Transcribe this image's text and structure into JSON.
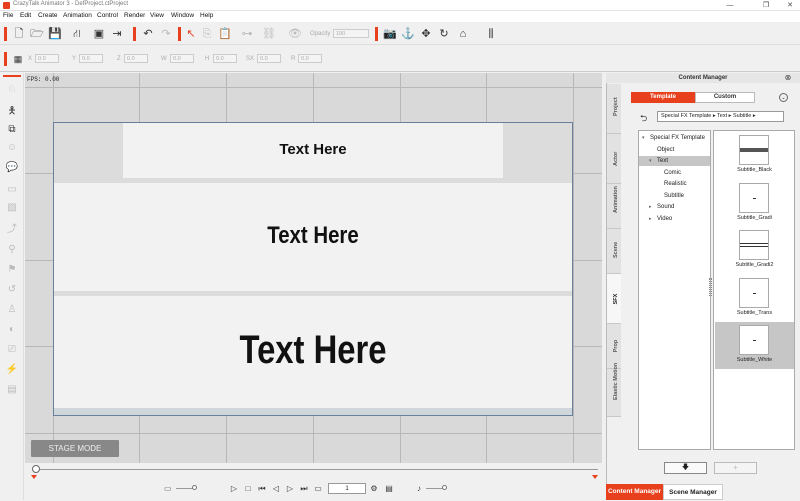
{
  "window": {
    "title": "CrazyTalk Animator 3  -  DefProject.ctProject",
    "min": "—",
    "max": "❐",
    "close": "✕"
  },
  "menu": [
    "File",
    "Edit",
    "Create",
    "Animation",
    "Control",
    "Render",
    "View",
    "Window",
    "Help"
  ],
  "toolbar": {
    "opacity_label": "Opacity",
    "opacity_value": "100"
  },
  "transform_fields": [
    {
      "label": "X",
      "value": "0.0"
    },
    {
      "label": "Y",
      "value": "0.0"
    },
    {
      "label": "Z",
      "value": "0.0"
    },
    {
      "label": "W",
      "value": "0.0"
    },
    {
      "label": "H",
      "value": "0.0"
    },
    {
      "label": "SX",
      "value": "0.0"
    },
    {
      "label": "R",
      "value": "0.0"
    }
  ],
  "stage": {
    "fps": "FPS: 0.00",
    "text_small": "Text Here",
    "text_medium": "Text Here",
    "text_large": "Text Here",
    "stage_mode": "STAGE MODE"
  },
  "timeline": {
    "frame": "1"
  },
  "content_manager": {
    "title": "Content Manager",
    "tabs": {
      "template": "Template",
      "custom": "Custom"
    },
    "side_tabs": [
      "Project",
      "Actor",
      "Animation",
      "Scene",
      "SFX",
      "Prop",
      "Elastic Motion"
    ],
    "active_side_tab": "SFX",
    "breadcrumb": "Special FX Template ▸ Text ▸ Subtitle ▸",
    "tree": [
      {
        "label": "Special FX Template",
        "indent": 0,
        "arrow": "▾"
      },
      {
        "label": "Object",
        "indent": 1,
        "arrow": ""
      },
      {
        "label": "Text",
        "indent": 1,
        "arrow": "▾",
        "selected": true
      },
      {
        "label": "Comic",
        "indent": 2,
        "arrow": ""
      },
      {
        "label": "Realistic",
        "indent": 2,
        "arrow": ""
      },
      {
        "label": "Subtitle",
        "indent": 2,
        "arrow": ""
      },
      {
        "label": "Sound",
        "indent": 1,
        "arrow": "▸"
      },
      {
        "label": "Video",
        "indent": 1,
        "arrow": "▸"
      }
    ],
    "thumbs": [
      {
        "label": "Subtitle_Black",
        "style": "black",
        "selected": false
      },
      {
        "label": "Subtitle_Gradi",
        "style": "dash",
        "selected": false
      },
      {
        "label": "Subtitle_Gradi2",
        "style": "lines",
        "selected": false
      },
      {
        "label": "Subtitle_Trans",
        "style": "dash",
        "selected": false
      },
      {
        "label": "Subtitle_White",
        "style": "dash",
        "selected": true
      }
    ],
    "bottom_tabs": {
      "content_manager": "Content Manager",
      "scene_manager": "Scene Manager"
    }
  }
}
